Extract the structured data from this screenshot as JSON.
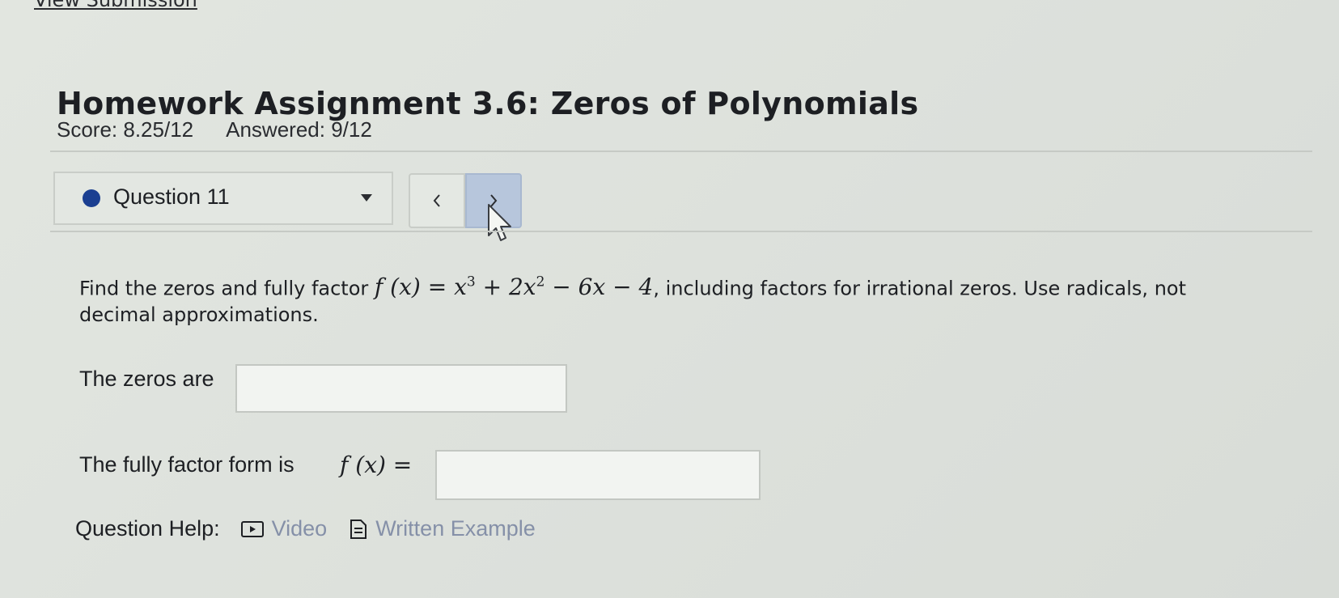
{
  "header": {
    "view_submission_label": "View Submission",
    "title": "Homework Assignment 3.6: Zeros of Polynomials",
    "score": "Score: 8.25/12",
    "answered": "Answered: 9/12"
  },
  "question_nav": {
    "selected_question": "Question 11",
    "status_color": "#1b3f91",
    "prev_label": "<",
    "next_label": ">"
  },
  "question": {
    "text_before": "Find the zeros and fully factor ",
    "function_lhs": "f (x) = ",
    "function_rhs_part1": "x",
    "exp1": "3",
    "function_rhs_part2": " + 2x",
    "exp2": "2",
    "function_rhs_part3": " − 6x − 4",
    "text_after": ", including factors for irrational zeros. Use radicals, not decimal approximations.",
    "zeros_label": "The zeros are",
    "zeros_value": "",
    "factor_label": "The fully factor form is",
    "factor_lhs": "f (x) =",
    "factor_value": ""
  },
  "help": {
    "label": "Question Help:",
    "video_label": "Video",
    "video_icon": "video-play-icon",
    "example_label": "Written Example",
    "example_icon": "document-icon",
    "link_color": "#8590a8"
  }
}
